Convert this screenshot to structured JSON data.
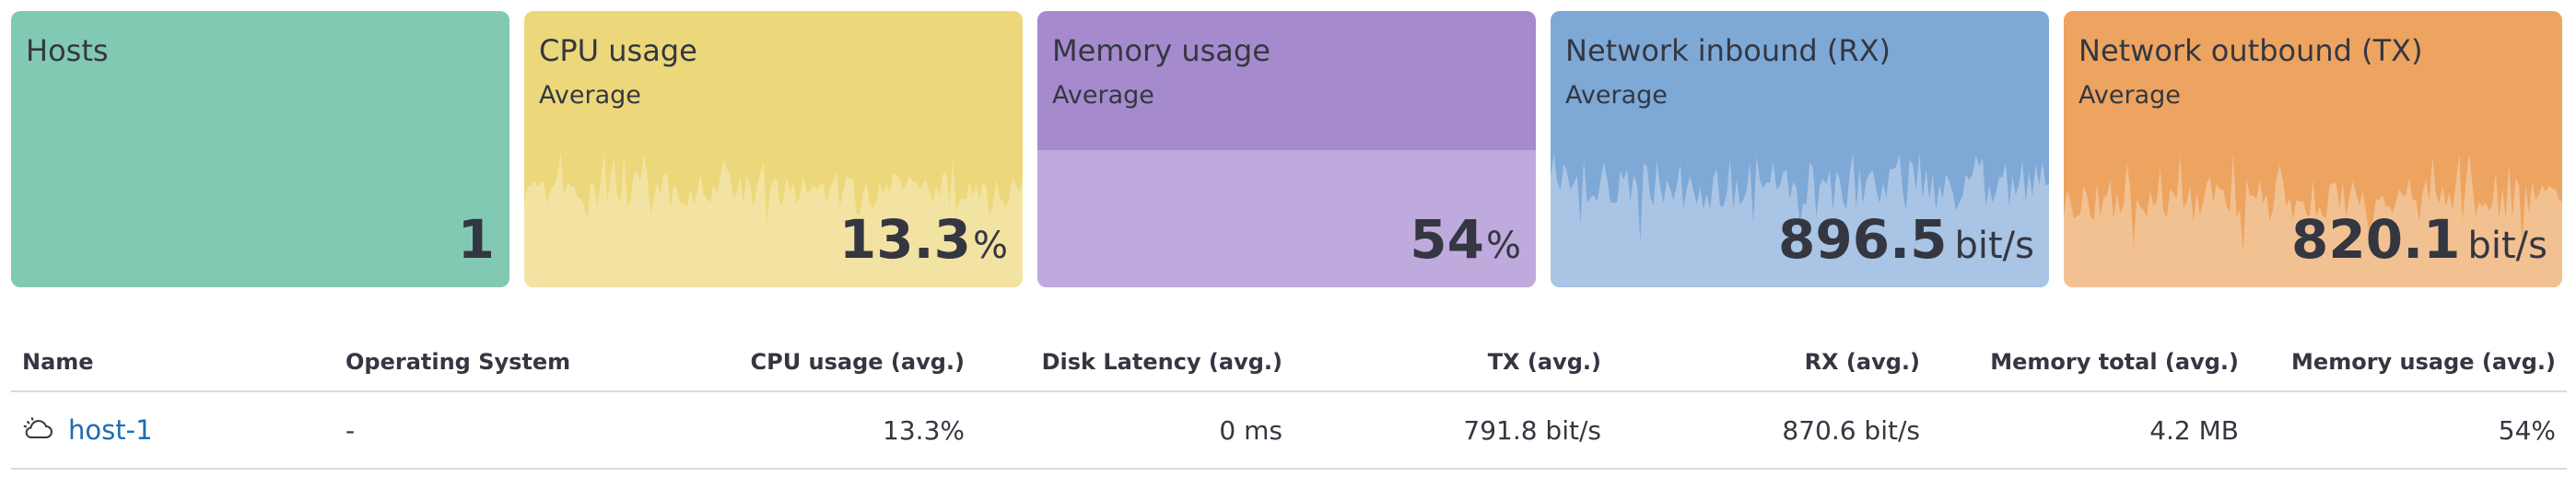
{
  "metrics": {
    "hosts": {
      "title": "Hosts",
      "value": "1",
      "color": "#82c9b3"
    },
    "cpu": {
      "title": "CPU usage",
      "subtitle": "Average",
      "value": "13.3",
      "unit": "%",
      "color": "#ecd87b",
      "trend_color": "#f3e3a2"
    },
    "memory": {
      "title": "Memory usage",
      "subtitle": "Average",
      "value": "54",
      "unit": "%",
      "color": "#a58bcd",
      "trend_color": "#bfaadd",
      "level": 0.54
    },
    "rx": {
      "title": "Network inbound (RX)",
      "subtitle": "Average",
      "value": "896.5",
      "unit": "bit/s",
      "color": "#7ea8d6",
      "trend_color": "#a9c4e4"
    },
    "tx": {
      "title": "Network outbound (TX)",
      "subtitle": "Average",
      "value": "820.1",
      "unit": "bit/s",
      "color": "#eda460",
      "trend_color": "#f2c192"
    }
  },
  "table": {
    "columns": {
      "name": "Name",
      "os": "Operating System",
      "cpu": "CPU usage (avg.)",
      "disk": "Disk Latency (avg.)",
      "tx": "TX (avg.)",
      "rx": "RX (avg.)",
      "mem_total": "Memory total (avg.)",
      "mem_usage": "Memory usage (avg.)"
    },
    "rows": [
      {
        "icon": "cloud-icon",
        "name": "host-1",
        "os": "-",
        "cpu": "13.3%",
        "disk": "0 ms",
        "tx": "791.8 bit/s",
        "rx": "870.6 bit/s",
        "mem_total": "4.2 MB",
        "mem_usage": "54%"
      }
    ]
  }
}
